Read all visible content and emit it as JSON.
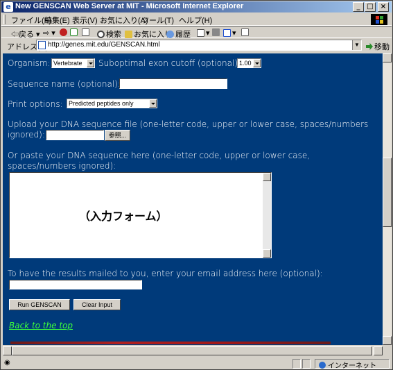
{
  "window": {
    "title": "New GENSCAN Web Server at MIT - Microsoft Internet Explorer",
    "minimize": "_",
    "maximize": "□",
    "close": "×"
  },
  "menu": {
    "items": [
      "ファイル(F)",
      "編集(E)",
      "表示(V)",
      "お気に入り(A)",
      "ツール(T)",
      "ヘルプ(H)"
    ]
  },
  "toolbar": {
    "back": "戻る",
    "search": "検索",
    "favorites": "お気に入り",
    "history": "履歴"
  },
  "address": {
    "label": "アドレス(D)",
    "url": "http://genes.mit.edu/GENSCAN.html",
    "go": "移動"
  },
  "form": {
    "organism_label": "Organism:",
    "organism_value": "Vertebrate",
    "cutoff_label": "Suboptimal exon cutoff (optional):",
    "cutoff_value": "1.00",
    "seqname_label": "Sequence name (optional):",
    "print_label": "Print options:",
    "print_value": "Predicted peptides only",
    "upload_label_1": "Upload your DNA sequence file (one-letter code, upper or lower case, spaces/numbers",
    "upload_label_2": "ignored):",
    "browse_button": "参照...",
    "paste_label_1": "Or paste your DNA sequence here (one-letter code, upper or lower case,",
    "paste_label_2": "spaces/numbers ignored):",
    "textarea_content": "（入力フォーム）",
    "email_label": "To have the results mailed to you, enter your email address here (optional):",
    "run_button": "Run GENSCAN",
    "clear_button": "Clear Input",
    "back_link": "Back to the top"
  },
  "status": {
    "zone": "インターネット"
  },
  "colors": {
    "page_background": "#003a7a",
    "link": "#3cff3c",
    "titlebar": "#0a246a"
  }
}
